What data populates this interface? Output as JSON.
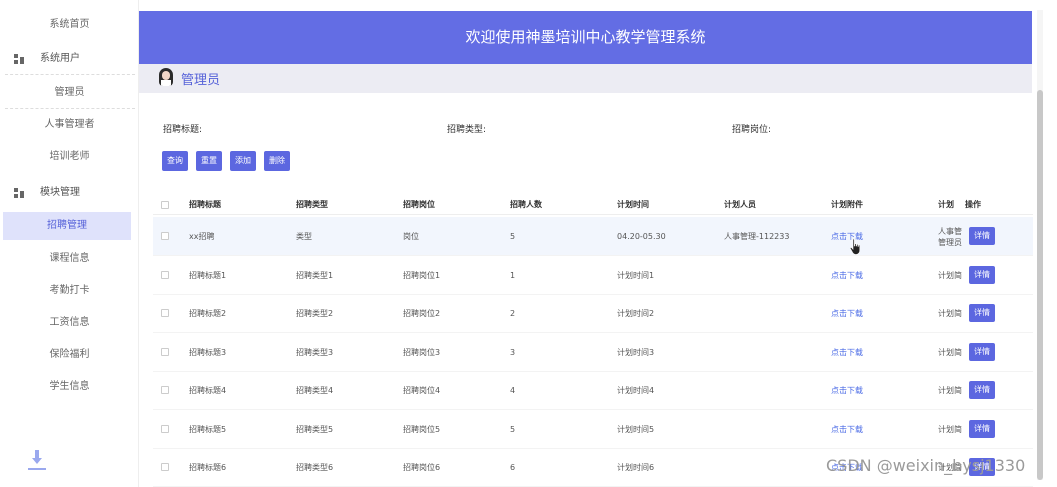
{
  "sidebar": {
    "items": [
      {
        "label": "系统首页"
      },
      {
        "label": "系统用户"
      },
      {
        "label": "管理员"
      },
      {
        "label": "人事管理者"
      },
      {
        "label": "培训老师"
      },
      {
        "label": "模块管理"
      },
      {
        "label": "招聘管理"
      },
      {
        "label": "课程信息"
      },
      {
        "label": "考勤打卡"
      },
      {
        "label": "工资信息"
      },
      {
        "label": "保险福利"
      },
      {
        "label": "学生信息"
      }
    ]
  },
  "header": {
    "title": "欢迎使用神墨培训中心教学管理系统"
  },
  "subbar": {
    "role": "管理员"
  },
  "filters": {
    "title_label": "招聘标题:",
    "type_label": "招聘类型:",
    "position_label": "招聘岗位:"
  },
  "buttons": {
    "query": "查询",
    "reset": "重置",
    "add": "添加",
    "delete": "删除"
  },
  "table": {
    "headers": [
      "招聘标题",
      "招聘类型",
      "招聘岗位",
      "招聘人数",
      "计划时间",
      "计划人员",
      "计划附件",
      "计划",
      "操作"
    ],
    "rows": [
      {
        "title": "xx招聘",
        "type": "类型",
        "position": "岗位",
        "count": "5",
        "time": "04.20-05.30",
        "person": "人事管理-112233",
        "attachment": "点击下载",
        "plan1": "人事管",
        "plan2": "管理员",
        "action": "详情"
      },
      {
        "title": "招聘标题1",
        "type": "招聘类型1",
        "position": "招聘岗位1",
        "count": "1",
        "time": "计划时间1",
        "person": "",
        "attachment": "点击下载",
        "plan1": "计划简",
        "plan2": "",
        "action": "详情"
      },
      {
        "title": "招聘标题2",
        "type": "招聘类型2",
        "position": "招聘岗位2",
        "count": "2",
        "time": "计划时间2",
        "person": "",
        "attachment": "点击下载",
        "plan1": "计划简",
        "plan2": "",
        "action": "详情"
      },
      {
        "title": "招聘标题3",
        "type": "招聘类型3",
        "position": "招聘岗位3",
        "count": "3",
        "time": "计划时间3",
        "person": "",
        "attachment": "点击下载",
        "plan1": "计划简",
        "plan2": "",
        "action": "详情"
      },
      {
        "title": "招聘标题4",
        "type": "招聘类型4",
        "position": "招聘岗位4",
        "count": "4",
        "time": "计划时间4",
        "person": "",
        "attachment": "点击下载",
        "plan1": "计划简",
        "plan2": "",
        "action": "详情"
      },
      {
        "title": "招聘标题5",
        "type": "招聘类型5",
        "position": "招聘岗位5",
        "count": "5",
        "time": "计划时间5",
        "person": "",
        "attachment": "点击下载",
        "plan1": "计划简",
        "plan2": "",
        "action": "详情"
      },
      {
        "title": "招聘标题6",
        "type": "招聘类型6",
        "position": "招聘岗位6",
        "count": "6",
        "time": "计划时间6",
        "person": "",
        "attachment": "点击下载",
        "plan1": "计划简",
        "plan2": "",
        "action": "详情"
      }
    ]
  },
  "watermark": "CSDN @weixin_bysj1330",
  "colors": {
    "accent": "#5c67e0",
    "header": "#636de4",
    "active_bg": "#dfe2fb",
    "link": "#4b6be6"
  }
}
